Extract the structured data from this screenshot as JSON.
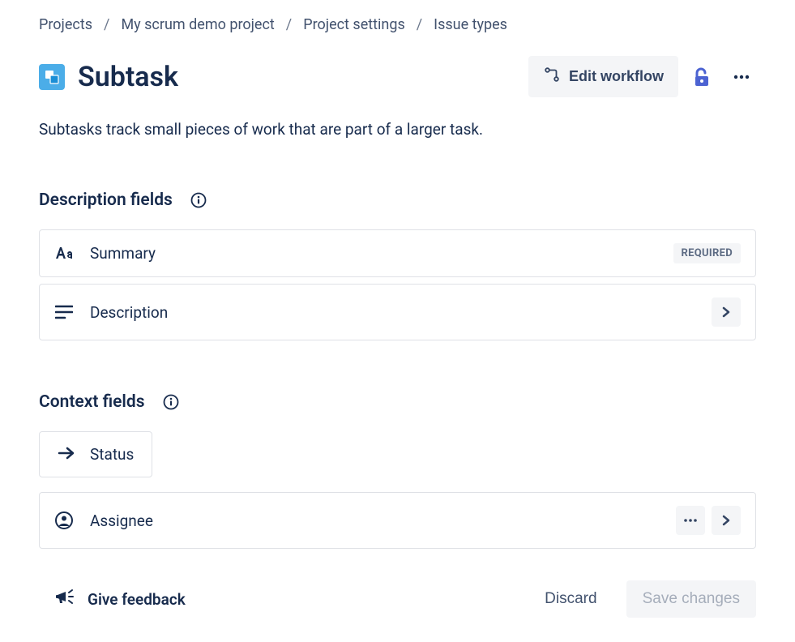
{
  "breadcrumb": {
    "items": [
      "Projects",
      "My scrum demo project",
      "Project settings",
      "Issue types"
    ]
  },
  "header": {
    "title": "Subtask",
    "edit_workflow_label": "Edit workflow"
  },
  "description": "Subtasks track small pieces of work that are part of a larger task.",
  "sections": {
    "description_fields": {
      "title": "Description fields",
      "fields": [
        {
          "label": "Summary",
          "required_badge": "REQUIRED"
        },
        {
          "label": "Description"
        }
      ]
    },
    "context_fields": {
      "title": "Context fields",
      "status_label": "Status",
      "fields": [
        {
          "label": "Assignee"
        }
      ]
    }
  },
  "footer": {
    "feedback_label": "Give feedback",
    "discard_label": "Discard",
    "save_label": "Save changes"
  }
}
